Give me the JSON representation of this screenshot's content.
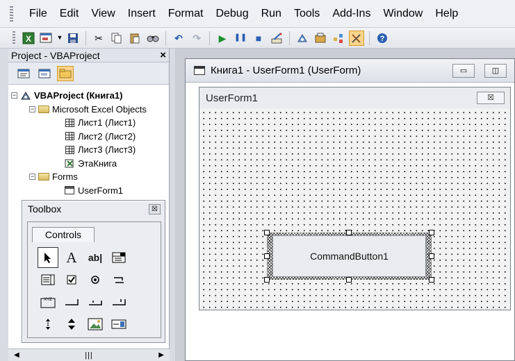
{
  "menu": {
    "items": [
      "File",
      "Edit",
      "View",
      "Insert",
      "Format",
      "Debug",
      "Run",
      "Tools",
      "Add-Ins",
      "Window",
      "Help"
    ]
  },
  "toolbar": {
    "buttons": [
      "excel-icon",
      "insert-userform-icon",
      "save-icon",
      "cut-icon",
      "copy-icon",
      "paste-icon",
      "find-icon",
      "undo-icon",
      "redo-icon",
      "run-icon",
      "break-icon",
      "reset-icon",
      "design-mode-icon",
      "project-explorer-icon",
      "properties-icon",
      "object-browser-icon",
      "toolbox-icon",
      "help-icon"
    ]
  },
  "project_pane": {
    "title": "Project - VBAProject",
    "close": "×",
    "tree": {
      "root": "VBAProject (Книга1)",
      "excel_objects": "Microsoft Excel Objects",
      "sheets": [
        "Лист1 (Лист1)",
        "Лист2 (Лист2)",
        "Лист3 (Лист3)"
      ],
      "workbook": "ЭтаКнига",
      "forms_folder": "Forms",
      "form": "UserForm1"
    }
  },
  "toolbox": {
    "title": "Toolbox",
    "close": "☒",
    "tab": "Controls",
    "controls": [
      "select-objects",
      "label",
      "textbox",
      "combobox",
      "listbox",
      "checkbox",
      "optionbutton",
      "togglebutton",
      "frame",
      "commandbutton",
      "tabstrip",
      "multipage",
      "scrollbar",
      "spinbutton",
      "image",
      "refedit"
    ]
  },
  "form_window": {
    "title": "Книга1 - UserForm1 (UserForm)",
    "minimize": "▭",
    "maximize": "◫"
  },
  "userform": {
    "caption": "UserForm1",
    "close": "☒",
    "command_button": "CommandButton1"
  }
}
